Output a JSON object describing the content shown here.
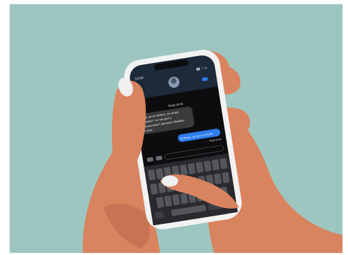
{
  "scene": {
    "background_color": "#9dc6c0",
    "skin_color": "#d9835f",
    "skin_shadow_color": "#b9664a",
    "phone_frame_color": "#f2f2f2",
    "screen_color": "#0d0d0f",
    "header_color": "#1c2a3a",
    "incoming_bubble_color": "#3a3a3c",
    "outgoing_bubble_color": "#2d7ef0",
    "keyboard_color": "#2a2a2e",
    "key_color": "#55565c"
  },
  "phone": {
    "status_time": "10:00",
    "day_label": "Today 10:40",
    "incoming_message": [
      "Ану, де ви живете, на якому",
      "поверсі і чи там досі у",
      "загальному? Допиши в Вайбер",
      "в Київ"
    ],
    "outgoing_message": "Живемо, ще досі на Київ!",
    "read_receipt": "Read 10:40"
  }
}
